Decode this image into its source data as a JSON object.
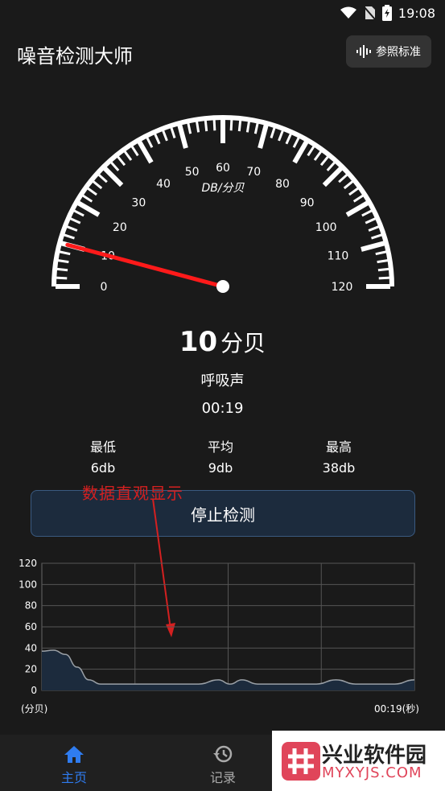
{
  "status_bar": {
    "time": "19:08",
    "icons": [
      "wifi-icon",
      "no-sim-icon",
      "battery-charging-icon"
    ]
  },
  "header": {
    "title": "噪音检测大师",
    "ref_button_label": "参照标准",
    "ref_button_icon": "sound-wave-icon"
  },
  "gauge": {
    "unit_label": "DB/分贝",
    "tick_labels": [
      "0",
      "10",
      "20",
      "30",
      "40",
      "50",
      "60",
      "70",
      "80",
      "90",
      "100",
      "110",
      "120"
    ],
    "min": 0,
    "max": 120,
    "needle_value": 10,
    "needle_color": "#ff1a1a"
  },
  "readout": {
    "value": "10",
    "unit": "分贝",
    "level": "呼吸声",
    "elapsed": "00:19"
  },
  "stats": {
    "min_label": "最低",
    "min_value": "6db",
    "avg_label": "平均",
    "avg_value": "9db",
    "max_label": "最高",
    "max_value": "38db"
  },
  "stop_button_label": "停止检测",
  "annotation": "数据直观显示",
  "chart_data": {
    "type": "area",
    "ylim": [
      0,
      120
    ],
    "yticks": [
      "120",
      "100",
      "80",
      "60",
      "40",
      "20",
      "0"
    ],
    "xlim": [
      0,
      19
    ],
    "x": [
      0,
      0.6,
      1.2,
      1.8,
      2.4,
      3.0,
      3.6,
      4.2,
      5,
      6,
      7,
      8,
      9,
      9.6,
      10.2,
      11,
      12,
      13,
      14,
      15,
      16,
      17,
      18,
      19
    ],
    "y": [
      37,
      38,
      34,
      22,
      10,
      6,
      6,
      6,
      6,
      6,
      6,
      6,
      10,
      6,
      10,
      6,
      6,
      6,
      6,
      10,
      6,
      6,
      6,
      10
    ],
    "ylabel": "(分贝)",
    "xlabel": "00:19(秒)",
    "fill_color": "#1c2b3d",
    "line_color": "#9aa0a6"
  },
  "bottom_nav": {
    "home_label": "主页",
    "records_label": "记录",
    "accent": "#2f7cf0"
  },
  "watermark": {
    "name": "兴业软件园",
    "url": "MYXYJS.COM"
  }
}
